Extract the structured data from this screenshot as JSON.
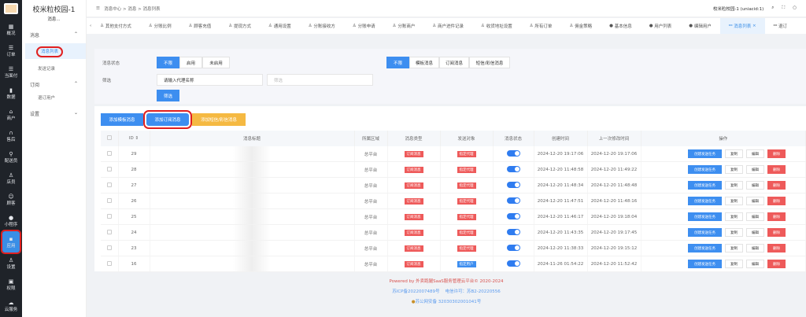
{
  "nav": {
    "items": [
      {
        "icon": "grid-icon",
        "label": "概况"
      },
      {
        "icon": "list-icon",
        "label": "订单"
      },
      {
        "icon": "list-icon",
        "label": "当面付"
      },
      {
        "icon": "chart-icon",
        "label": "数据"
      },
      {
        "icon": "store-icon",
        "label": "商户"
      },
      {
        "icon": "headset-icon",
        "label": "售后"
      },
      {
        "icon": "rider-icon",
        "label": "配送员"
      },
      {
        "icon": "user-icon",
        "label": "店员"
      },
      {
        "icon": "customer-icon",
        "label": "顾客"
      },
      {
        "icon": "wechat-icon",
        "label": "小程序"
      },
      {
        "icon": "apps-icon",
        "label": "应用"
      },
      {
        "icon": "user-icon",
        "label": "设置"
      },
      {
        "icon": "lock-icon",
        "label": "权限"
      },
      {
        "icon": "cloud-icon",
        "label": "云服务"
      }
    ]
  },
  "sub": {
    "title": "校米粒校园-1",
    "subtitle": "消息...",
    "groups": [
      {
        "label": "消息",
        "items": [
          "消息列表",
          "发送记录"
        ]
      },
      {
        "label": "订阅",
        "items": [
          "退订用户"
        ]
      },
      {
        "label": "设置",
        "items": []
      }
    ]
  },
  "top": {
    "breadcrumb": [
      "消息中心",
      "消息",
      "消息列表"
    ],
    "account": "校米粒校园-1 (uniacid:1)"
  },
  "tabs": [
    "其他支付方式",
    "分账比例",
    "顾客充值",
    "提现方式",
    "通用设置",
    "分账接收方",
    "分账申请",
    "分账商户",
    "商户进件记录",
    "收货地址设置",
    "所有订单",
    "佣金策略",
    "基本信息",
    "用户列表",
    "编辑用户",
    "消息列表",
    "退订"
  ],
  "filter": {
    "status_label": "消息状态",
    "status_options": [
      "不限",
      "启用",
      "未启用"
    ],
    "type_options": [
      "不限",
      "模板消息",
      "订阅消息",
      "短信/彩信消息"
    ],
    "filter_label": "筛选",
    "agent_placeholder": "请输入代理名称",
    "filter_placeholder": "筛选",
    "filter_button": "筛选"
  },
  "actions": {
    "add_template": "添加模板消息",
    "add_subscribe": "添加订阅消息",
    "add_sms": "添加短信/彩信消息"
  },
  "table": {
    "headers": [
      "ID ⇕",
      "消息标题",
      "所属区域",
      "消息类型",
      "发送对象",
      "消息状态",
      "创建时间",
      "上一次修改时间",
      "操作"
    ],
    "ops": [
      "创建发送任务",
      "复制",
      "编辑",
      "删除"
    ],
    "rows": [
      {
        "id": "29",
        "region": "总平台",
        "type": "订阅消息",
        "target": "指定代理",
        "created": "2024-12-20 19:17:06",
        "modified": "2024-12-20 19:17:06"
      },
      {
        "id": "28",
        "region": "总平台",
        "type": "订阅消息",
        "target": "指定代理",
        "created": "2024-12-20 11:48:58",
        "modified": "2024-12-20 11:49:22"
      },
      {
        "id": "27",
        "region": "总平台",
        "type": "订阅消息",
        "target": "指定代理",
        "created": "2024-12-20 11:48:34",
        "modified": "2024-12-20 11:48:48"
      },
      {
        "id": "26",
        "region": "总平台",
        "type": "订阅消息",
        "target": "指定代理",
        "created": "2024-12-20 11:47:51",
        "modified": "2024-12-20 11:48:16"
      },
      {
        "id": "25",
        "region": "总平台",
        "type": "订阅消息",
        "target": "指定代理",
        "created": "2024-12-20 11:46:17",
        "modified": "2024-12-20 19:18:04"
      },
      {
        "id": "24",
        "region": "总平台",
        "type": "订阅消息",
        "target": "指定代理",
        "created": "2024-12-20 11:43:35",
        "modified": "2024-12-20 19:17:45"
      },
      {
        "id": "23",
        "region": "总平台",
        "type": "订阅消息",
        "target": "指定代理",
        "created": "2024-12-20 11:38:33",
        "modified": "2024-12-20 19:15:12"
      },
      {
        "id": "16",
        "region": "总平台",
        "type": "订阅消息",
        "target": "指定用户",
        "created": "2024-11-26 01:54:22",
        "modified": "2024-12-20 11:52:42"
      }
    ]
  },
  "footer": {
    "powered": "Powered by 外卖跑腿SaaS服务管理云平台© 2020-2024",
    "icp": "苏ICP备2022007489号",
    "license": "电信许可：苏B2-20220556",
    "police": "苏公网安备 32030302001041号"
  },
  "colors": {
    "primary": "#3d8ef0",
    "danger": "#ee5a5a",
    "warning": "#f5b942",
    "nav": "#1f2329"
  }
}
